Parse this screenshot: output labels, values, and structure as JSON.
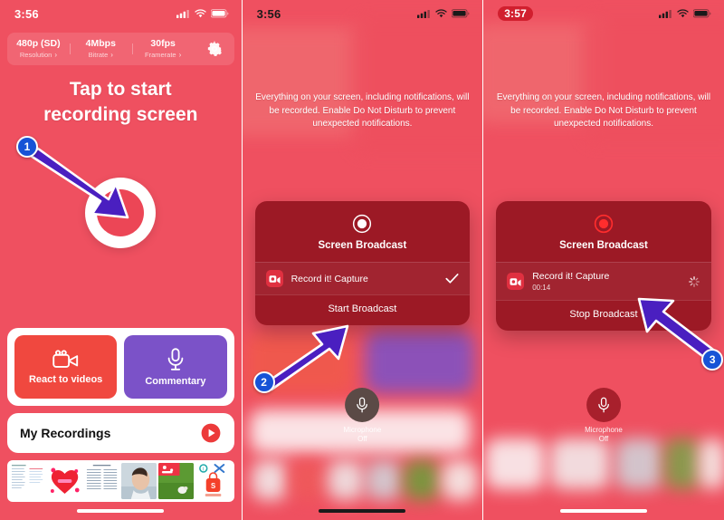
{
  "accent": {
    "background": "#ef5060",
    "record_red": "#ec4656",
    "react_red": "#f0483f",
    "commentary_purple": "#7b52c8",
    "arrow_purple": "#4a1fc0",
    "badge_blue": "#1753d6",
    "sheet_dark_red": "#961620"
  },
  "panel1": {
    "statusbar": {
      "clock": "3:56",
      "cellular_icon": "signal-bars-icon",
      "wifi_icon": "wifi-icon",
      "battery_icon": "battery-icon"
    },
    "settings": [
      {
        "value": "480p (SD)",
        "label": "Resolution",
        "chevron": "›"
      },
      {
        "value": "4Mbps",
        "label": "Bitrate",
        "chevron": "›"
      },
      {
        "value": "30fps",
        "label": "Framerate",
        "chevron": "›"
      }
    ],
    "gear_icon": "gear-icon",
    "headline_line1": "Tap to start",
    "headline_line2": "recording screen",
    "record_button": "record-button",
    "actions": [
      {
        "label": "React to videos",
        "icon": "video-camera-icon",
        "color": "#f0483f"
      },
      {
        "label": "Commentary",
        "icon": "microphone-icon",
        "color": "#7b52c8"
      }
    ],
    "recordings": {
      "label": "My Recordings",
      "play_icon": "play-circle-icon"
    },
    "thumbnails": [
      "document-thumbnail",
      "red-heart-thumbnail",
      "list-document-thumbnail",
      "person-photo-thumbnail",
      "green-field-thumbnail",
      "shopping-app-thumbnail"
    ]
  },
  "panel2": {
    "statusbar": {
      "clock": "3:56"
    },
    "notice": "Everything on your screen, including notifications, will be recorded. Enable Do Not Disturb to prevent unexpected notifications.",
    "sheet": {
      "record_icon": "record-dot-icon",
      "title": "Screen Broadcast",
      "app_icon": "record-it-capture-icon",
      "app_name": "Record it! Capture",
      "app_timer": "",
      "trailing_icon": "checkmark-icon",
      "action": "Start Broadcast"
    },
    "mic": {
      "icon": "microphone-icon",
      "label_line1": "Microphone",
      "label_line2": "Off"
    }
  },
  "panel3": {
    "statusbar": {
      "clock": "3:57",
      "recording_pill": true
    },
    "notice": "Everything on your screen, including notifications, will be recorded. Enable Do Not Disturb to prevent unexpected notifications.",
    "sheet": {
      "record_icon": "record-dot-active-icon",
      "title": "Screen Broadcast",
      "app_icon": "record-it-capture-icon",
      "app_name": "Record it! Capture",
      "app_timer": "00:14",
      "trailing_icon": "spinner-icon",
      "action": "Stop Broadcast"
    },
    "mic": {
      "icon": "microphone-icon",
      "label_line1": "Microphone",
      "label_line2": "Off"
    }
  },
  "annotations": {
    "step1": "1",
    "step2": "2",
    "step3": "3"
  }
}
